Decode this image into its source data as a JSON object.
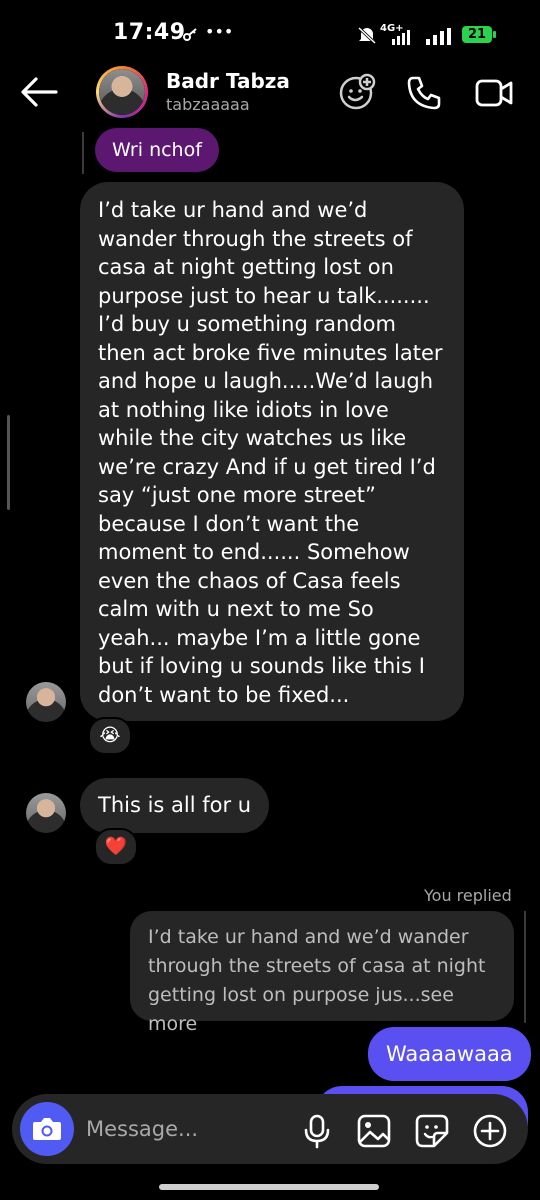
{
  "status_bar": {
    "time": "17:49",
    "network": "4G+",
    "battery": "21"
  },
  "header": {
    "name": "Badr Tabza",
    "handle": "tabzaaaaa"
  },
  "messages": {
    "purple_chip": "Wri nchof",
    "long_message": "I’d take ur hand and we’d wander through the streets of casa at night getting lost on purpose just to hear u talk........ I’d buy u something random then act broke five minutes later and hope u laugh.....We’d laugh at nothing like idiots in love while the city watches us like we’re crazy And if u get tired I’d say “just one more street” because I don’t want the moment to end...... Somehow even the chaos of Casa feels calm with u next to me So yeah... maybe I’m a little gone but if loving u sounds like this I don’t want to be fixed...",
    "long_reaction": "😭",
    "short_message": "This is all for u",
    "short_reaction": "❤️",
    "you_replied": "You replied",
    "reply_preview": "I’d take ur hand and we’d wander through the streets of casa at night getting lost on purpose jus...see more",
    "outgoing": "Waaaawaaa"
  },
  "composer": {
    "placeholder": "Message..."
  },
  "icons": {
    "back": "back-arrow-icon",
    "effects": "face-effect-icon",
    "call": "phone-icon",
    "video": "video-call-icon",
    "camera": "camera-icon",
    "mic": "microphone-icon",
    "gallery": "image-icon",
    "sticker": "sticker-icon",
    "plus": "plus-circle-icon"
  },
  "colors": {
    "outgoing_bubble": "#5a4ff0",
    "incoming_bubble": "#262626",
    "purple_chip": "#5c1870",
    "camera_button": "#4f5bf3",
    "battery": "#2bd24b"
  }
}
